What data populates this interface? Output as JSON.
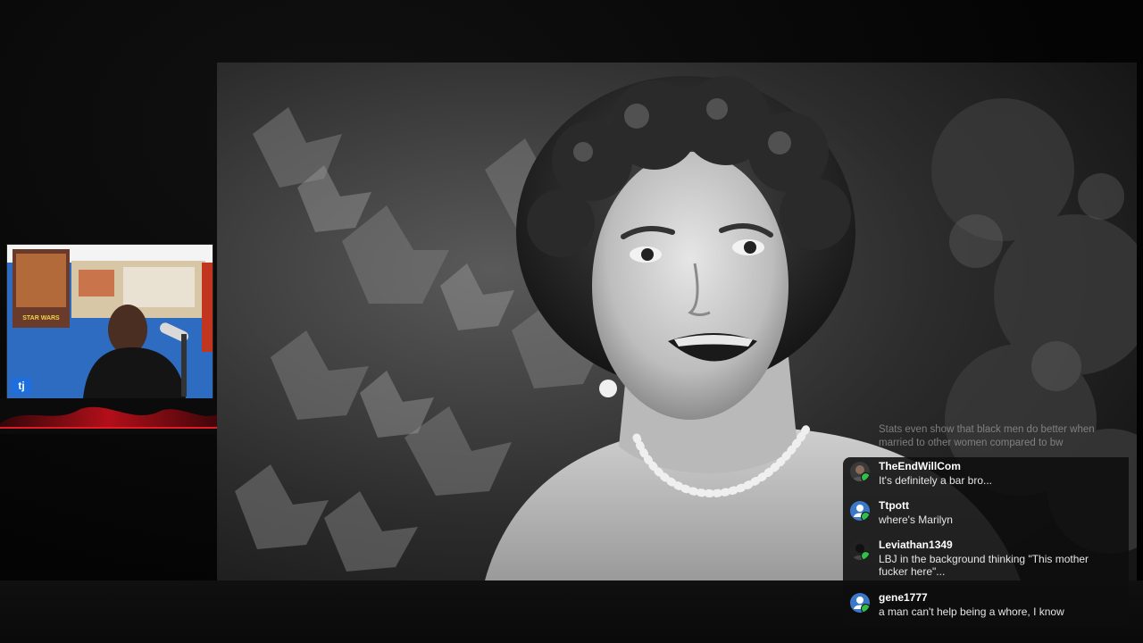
{
  "webcam": {
    "tag_label": "tj",
    "poster_title": "STAR WARS"
  },
  "chat": {
    "faded_message": "Stats even show that black men do better when married to other women compared to bw",
    "messages": [
      {
        "username": "TheEndWillCom",
        "text": "It's definitely a bar bro...",
        "avatar": "photo-avatar-icon"
      },
      {
        "username": "Ttpott",
        "text": "where's Marilyn",
        "avatar": "default-user-avatar-icon"
      },
      {
        "username": "Leviathan1349",
        "text": "LBJ in the background thinking \"This mother fucker here\"...",
        "avatar": "photo-avatar-icon"
      },
      {
        "username": "gene1777",
        "text": "a man can't help being a whore, I know",
        "avatar": "default-user-avatar-icon"
      }
    ]
  },
  "colors": {
    "background": "#050505",
    "chat_panel": "#0e0e0e",
    "online_dot": "#2fbf4a",
    "avatar_blue": "#3c78c8",
    "webcam_tag": "#1d6fe0",
    "accent_red": "#d0101c"
  }
}
